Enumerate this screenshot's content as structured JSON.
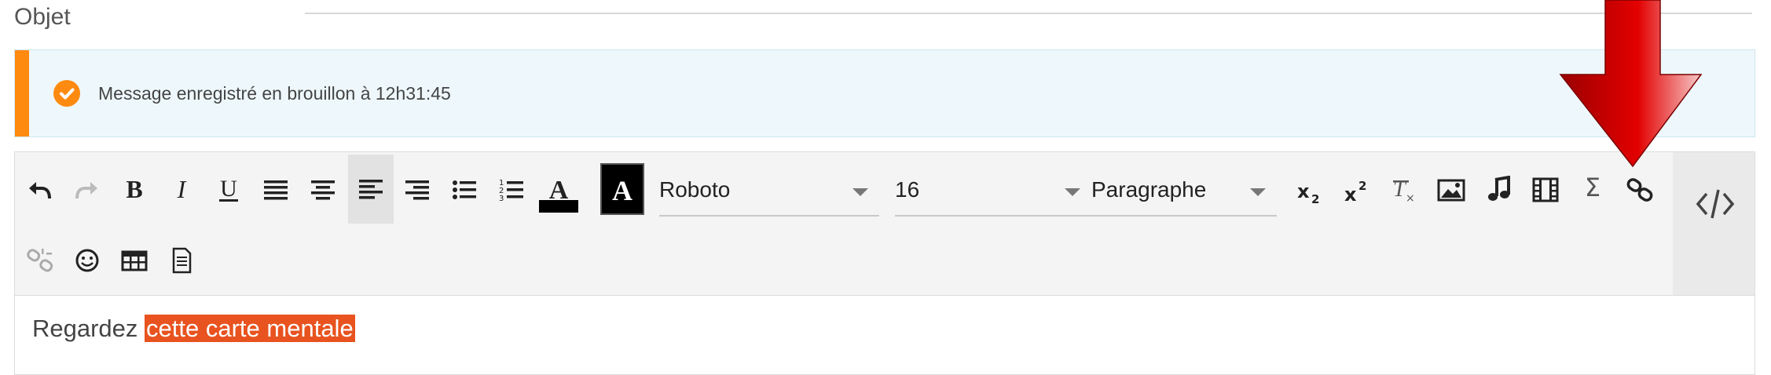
{
  "subject": {
    "label": "Objet"
  },
  "alert": {
    "message": "Message enregistré en brouillon à 12h31:45",
    "accent_color": "#ff8a10",
    "icon": "check-circle-icon"
  },
  "toolbar": {
    "font": {
      "value": "Roboto"
    },
    "size": {
      "value": "16"
    },
    "format": {
      "value": "Paragraphe"
    },
    "active_button": "align-left",
    "buttons_row1": [
      "undo",
      "redo",
      "bold",
      "italic",
      "underline",
      "align-justify",
      "align-center",
      "align-left",
      "align-right",
      "bullet-list",
      "numbered-list",
      "text-color",
      "background-color",
      "font",
      "size",
      "format",
      "subscript",
      "superscript",
      "clear-format",
      "image",
      "audio",
      "video",
      "formula",
      "link"
    ],
    "buttons_row2": [
      "unlink",
      "emoji",
      "table",
      "template"
    ],
    "source_button": "source-code"
  },
  "content": {
    "text_before": "Regardez",
    "highlighted": "cette carte mentale",
    "highlight_color": "#e8531f"
  },
  "annotation": {
    "arrow_color": "#e10000",
    "points_to": "link"
  }
}
